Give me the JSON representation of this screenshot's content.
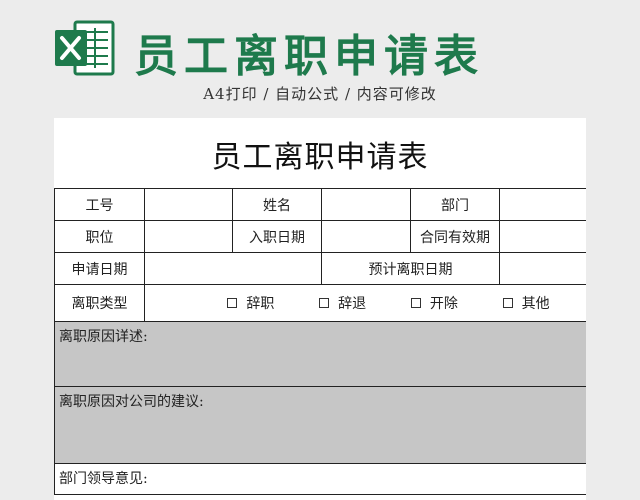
{
  "banner": {
    "title": "员工离职申请表",
    "subtitle": "A4打印 / 自动公式 / 内容可修改",
    "icon": "excel-icon",
    "accent_color": "#1e7a4c"
  },
  "sheet": {
    "title": "员工离职申请表",
    "labels": {
      "employee_no": "工号",
      "name": "姓名",
      "department": "部门",
      "position": "职位",
      "hire_date": "入职日期",
      "contract_expiry": "合同有效期",
      "apply_date": "申请日期",
      "expected_leave_date": "预计离职日期",
      "leave_type": "离职类型"
    },
    "leave_types": [
      "辞职",
      "辞退",
      "开除",
      "其他"
    ],
    "reason_label": "离职原因详述:",
    "suggestion_label": "离职原因对公司的建议:",
    "dept_opinion_label": "部门领导意见:"
  }
}
